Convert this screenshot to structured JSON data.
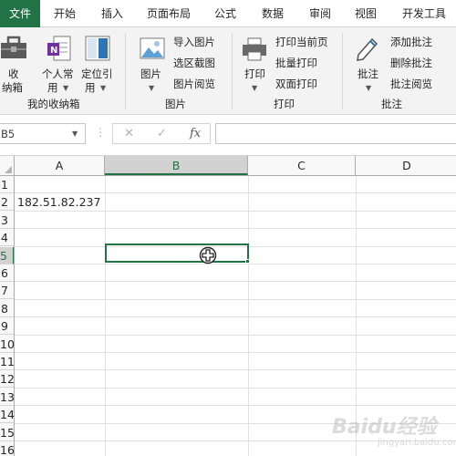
{
  "tabs": [
    {
      "label": "文件",
      "active": true
    },
    {
      "label": "开始"
    },
    {
      "label": "插入"
    },
    {
      "label": "页面布局"
    },
    {
      "label": "公式"
    },
    {
      "label": "数据"
    },
    {
      "label": "审阅"
    },
    {
      "label": "视图"
    },
    {
      "label": "开发工具"
    }
  ],
  "ribbon": {
    "groups": {
      "favorites": {
        "label": "我的收纳箱",
        "btn_store_line1": "收",
        "btn_store_line2": "纳箱",
        "btn_personal_line1": "个人常",
        "btn_personal_line2": "用",
        "btn_locate_line1": "定位引",
        "btn_locate_line2": "用"
      },
      "picture": {
        "label": "图片",
        "btn_picture": "图片",
        "items": [
          "导入图片",
          "选区截图",
          "图片阅览"
        ]
      },
      "print": {
        "label": "打印",
        "btn_print": "打印",
        "items": [
          "打印当前页",
          "批量打印",
          "双面打印"
        ]
      },
      "comment": {
        "label": "批注",
        "btn_comment": "批注",
        "items": [
          "添加批注",
          "删除批注",
          "批注阅览"
        ]
      }
    }
  },
  "formula_bar": {
    "name_box": "B5",
    "cancel_icon": "✕",
    "enter_icon": "✓",
    "fx_label": "fx",
    "formula": ""
  },
  "grid": {
    "columns": [
      "A",
      "B",
      "C",
      "D"
    ],
    "selected_column": "B",
    "rows": [
      "1",
      "2",
      "3",
      "4",
      "5",
      "6",
      "7",
      "8",
      "9",
      "10",
      "11",
      "12",
      "13",
      "14",
      "15",
      "16"
    ],
    "selected_row": "5",
    "cells": {
      "A2": "182.51.82.237"
    }
  },
  "watermark": {
    "text": "Baidu经验",
    "sub": "jingyan.baidu.com"
  },
  "colors": {
    "accent": "#217346",
    "ribbon_bg": "#f3f3f3"
  }
}
